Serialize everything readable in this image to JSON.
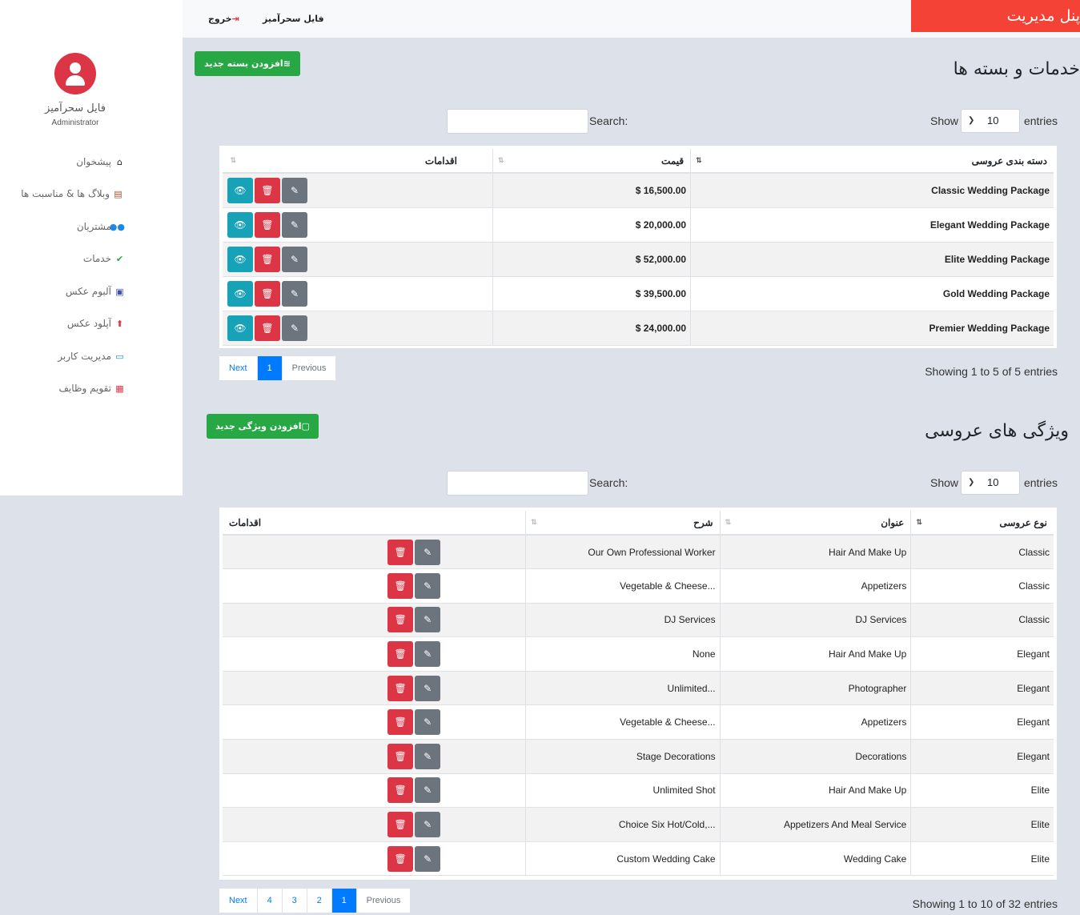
{
  "brand": "پنل مدیریت",
  "topbar": {
    "user_link": "فایل سحرآمیز",
    "logout": "خروج"
  },
  "user": {
    "name": "فایل سحرآمیز",
    "role": "Administrator"
  },
  "sidebar": {
    "items": [
      {
        "label": "پیشخوان",
        "icon": "home-icon",
        "color": "#222222"
      },
      {
        "label": "وبلاگ ها & مناسبت ها",
        "icon": "comment-icon",
        "color": "#a0522d"
      },
      {
        "label": "مشتریان",
        "icon": "users-icon",
        "color": "#1e88e5"
      },
      {
        "label": "خدمات",
        "icon": "shield-check-icon",
        "color": "#28a745"
      },
      {
        "label": "آلبوم عکس",
        "icon": "images-icon",
        "color": "#3f51b5"
      },
      {
        "label": "آپلود عکس",
        "icon": "upload-icon",
        "color": "#dc3545"
      },
      {
        "label": "مدیریت کاربر",
        "icon": "id-card-icon",
        "color": "#1e88e5"
      },
      {
        "label": "تقویم وظایف",
        "icon": "calendar-icon",
        "color": "#dc3545"
      }
    ]
  },
  "packages": {
    "title": "خدمات و بسته ها",
    "add_button": "افزودن بسته جدید",
    "show_label": "Show",
    "entries_label": "entries",
    "search_label": "Search:",
    "page_size": "10",
    "columns": [
      "دسته بندی عروسی",
      "قیمت",
      "اقدامات"
    ],
    "rows": [
      {
        "name": "Classic Wedding Package",
        "price": "16,500.00 $"
      },
      {
        "name": "Elegant Wedding Package",
        "price": "20,000.00 $"
      },
      {
        "name": "Elite Wedding Package",
        "price": "52,000.00 $"
      },
      {
        "name": "Gold Wedding Package",
        "price": "39,500.00 $"
      },
      {
        "name": "Premier Wedding Package",
        "price": "24,000.00 $"
      }
    ],
    "pager": {
      "next": "Next",
      "pages": [
        "1"
      ],
      "previous": "Previous"
    },
    "info": "Showing 1 to 5 of 5 entries"
  },
  "features": {
    "title": "ویژگی های عروسی",
    "add_button": "افزودن ویژگی جدید",
    "show_label": "Show",
    "entries_label": "entries",
    "search_label": "Search:",
    "page_size": "10",
    "columns": [
      "نوع عروسی",
      "عنوان",
      "شرح",
      "اقدامات"
    ],
    "rows": [
      {
        "type": "Classic",
        "title": "Hair And Make Up",
        "desc": "Our Own Professional Worker"
      },
      {
        "type": "Classic",
        "title": "Appetizers",
        "desc": "...Vegetable & Cheese"
      },
      {
        "type": "Classic",
        "title": "DJ Services",
        "desc": "DJ Services"
      },
      {
        "type": "Elegant",
        "title": "Hair And Make Up",
        "desc": "None"
      },
      {
        "type": "Elegant",
        "title": "Photographer",
        "desc": "...Unlimited"
      },
      {
        "type": "Elegant",
        "title": "Appetizers",
        "desc": "...Vegetable & Cheese"
      },
      {
        "type": "Elegant",
        "title": "Decorations",
        "desc": "Stage Decorations"
      },
      {
        "type": "Elite",
        "title": "Hair And Make Up",
        "desc": "Unlimited Shot"
      },
      {
        "type": "Elite",
        "title": "Appetizers And Meal Service",
        "desc": "...,Choice Six Hot/Cold"
      },
      {
        "type": "Elite",
        "title": "Wedding Cake",
        "desc": "Custom Wedding Cake"
      }
    ],
    "pager": {
      "next": "Next",
      "pages": [
        "4",
        "3",
        "2",
        "1"
      ],
      "previous": "Previous"
    },
    "info": "Showing 1 to 10 of 32 entries"
  }
}
